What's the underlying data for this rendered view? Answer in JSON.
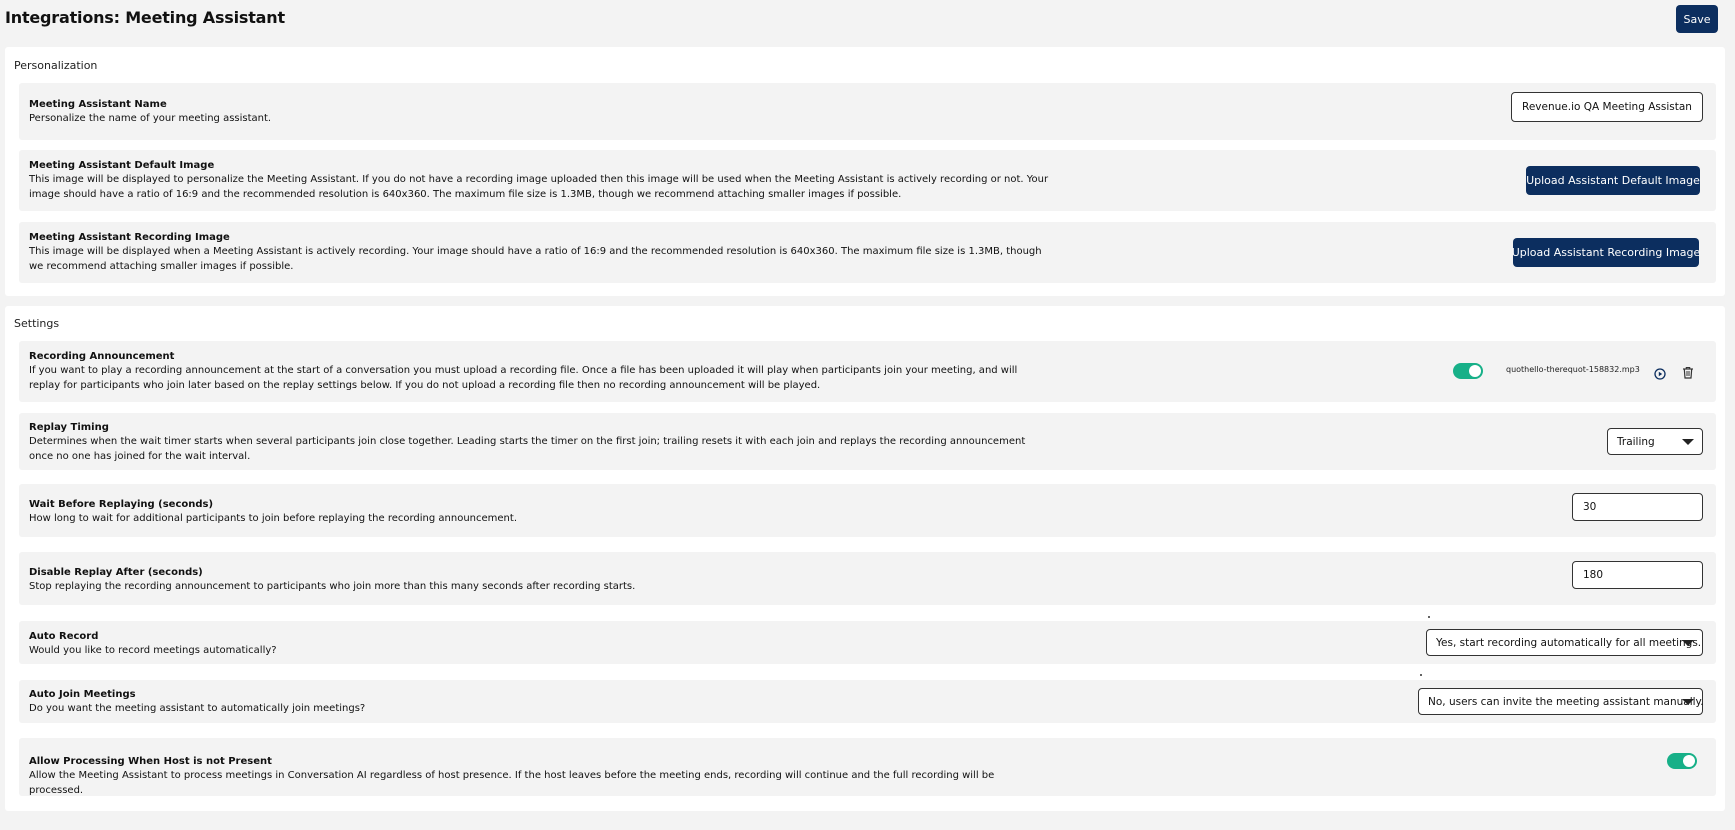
{
  "page": {
    "title": "Integrations: Meeting Assistant",
    "save_label": "Save"
  },
  "personalization": {
    "title": "Personalization",
    "name": {
      "label": "Meeting Assistant Name",
      "desc": "Personalize the name of your meeting assistant.",
      "value": "Revenue.io QA Meeting Assistant"
    },
    "default_image": {
      "label": "Meeting Assistant Default Image",
      "desc": "This image will be displayed to personalize the Meeting Assistant. If you do not have a recording image uploaded then this image will be used when the Meeting Assistant is actively recording or not. Your image should have a ratio of 16:9 and the recommended resolution is 640x360. The maximum file size is 1.3MB, though we recommend attaching smaller images if possible.",
      "button": "Upload Assistant Default Image"
    },
    "recording_image": {
      "label": "Meeting Assistant Recording Image",
      "desc": "This image will be displayed when a Meeting Assistant is actively recording. Your image should have a ratio of 16:9 and the recommended resolution is 640x360. The maximum file size is 1.3MB, though we recommend attaching smaller images if possible.",
      "button": "Upload Assistant Recording Image"
    }
  },
  "settings": {
    "title": "Settings",
    "announcement": {
      "label": "Recording Announcement",
      "desc": "If you want to play a recording announcement at the start of a conversation you must upload a recording file. Once a file has been uploaded it will play when participants join your meeting, and will replay for participants who join later based on the replay settings below. If you do not upload a recording file then no recording announcement will be played.",
      "enabled": true,
      "file_name": "quothello-therequot-158832.mp3",
      "play_icon": "play-circle-icon",
      "delete_icon": "trash-icon"
    },
    "replay_timing": {
      "label": "Replay Timing",
      "desc": "Determines when the wait timer starts when several participants join close together. Leading starts the timer on the first join; trailing resets it with each join and replays the recording announcement once no one has joined for the wait interval.",
      "value": "Trailing"
    },
    "wait_before": {
      "label": "Wait Before Replaying (seconds)",
      "desc": "How long to wait for additional participants to join before replaying the recording announcement.",
      "value": "30"
    },
    "disable_after": {
      "label": "Disable Replay After (seconds)",
      "desc": "Stop replaying the recording announcement to participants who join more than this many seconds after recording starts.",
      "value": "180"
    },
    "auto_record": {
      "label": "Auto Record",
      "desc": "Would you like to record meetings automatically?",
      "value": "Yes, start recording automatically for all meetings."
    },
    "auto_join": {
      "label": "Auto Join Meetings",
      "desc": "Do you want the meeting assistant to automatically join meetings?",
      "value": "No, users can invite the meeting assistant manually."
    },
    "host_absent": {
      "label": "Allow Processing When Host is not Present",
      "desc": "Allow the Meeting Assistant to process meetings in Conversation AI regardless of host presence. If the host leaves before the meeting ends, recording will continue and the full recording will be processed.",
      "enabled": true
    }
  },
  "colors": {
    "primary": "#0c2e5f",
    "toggle_on": "#17b088",
    "row_bg": "#f3f3f3"
  }
}
